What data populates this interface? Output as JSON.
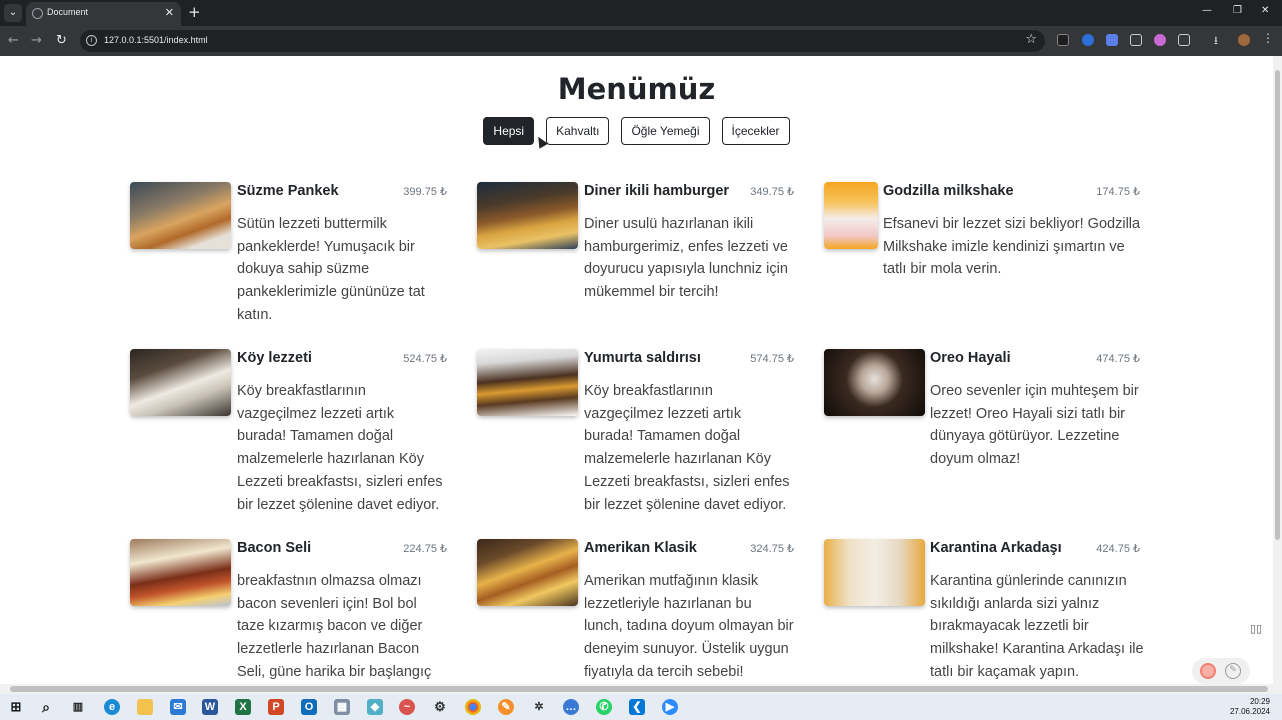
{
  "browser": {
    "tab_title": "Document",
    "url": "127.0.0.1:5501/index.html"
  },
  "page": {
    "heading": "Menümüz",
    "filters": [
      "Hepsi",
      "Kahvaltı",
      "Öğle Yemeği",
      "İçecekler"
    ],
    "active_filter": "Hepsi",
    "items": [
      {
        "title": "Süzme Pankek",
        "price": "399.75 ₺",
        "desc": "Sütün lezzeti buttermilk pankeklerde! Yumuşacık bir dokuya sahip süzme pankeklerimizle gününüze tat katın.",
        "image": "pancake-stack-photo"
      },
      {
        "title": "Diner ikili hamburger",
        "price": "349.75 ₺",
        "desc": "Diner usulü hazırlanan ikili hamburgerimiz, enfes lezzeti ve doyurucu yapısıyla lunchniz için mükemmel bir tercih!",
        "image": "double-burger-photo"
      },
      {
        "title": "Godzilla milkshake",
        "price": "174.75 ₺",
        "desc": "Efsanevi bir lezzet sizi bekliyor! Godzilla Milkshake imizle kendinizi şımartın ve tatlı bir mola verin.",
        "image": "milkshake-photo"
      },
      {
        "title": "Köy lezzeti",
        "price": "524.75 ₺",
        "desc": "Köy breakfastlarının vazgeçilmez lezzeti artık burada! Tamamen doğal malzemelerle hazırlanan Köy Lezzeti breakfastsı, sizleri enfes bir lezzet şölenine davet ediyor.",
        "image": "village-breakfast-photo"
      },
      {
        "title": "Yumurta saldırısı",
        "price": "574.75 ₺",
        "desc": "Köy breakfastlarının vazgeçilmez lezzeti artık burada! Tamamen doğal malzemelerle hazırlanan Köy Lezzeti breakfastsı, sizleri enfes bir lezzet şölenine davet ediyor.",
        "image": "egg-burger-photo"
      },
      {
        "title": "Oreo Hayali",
        "price": "474.75 ₺",
        "desc": "Oreo sevenler için muhteşem bir lezzet! Oreo Hayali sizi tatlı bir dünyaya götürüyor. Lezzetine doyum olmaz!",
        "image": "oreo-shake-photo"
      },
      {
        "title": "Bacon Seli",
        "price": "224.75 ₺",
        "desc": "breakfastnın olmazsa olmazı bacon sevenleri için! Bol bol taze kızarmış bacon ve diğer lezzetlerle hazırlanan Bacon Seli, güne harika bir başlangıç",
        "image": "bacon-sandwich-photo"
      },
      {
        "title": "Amerikan Klasik",
        "price": "324.75 ₺",
        "desc": "Amerikan mutfağının klasik lezzetleriyle hazırlanan bu lunch, tadına doyum olmayan bir deneyim sunuyor. Üstelik uygun fiyatıyla da tercih sebebi!",
        "image": "burger-fries-photo"
      },
      {
        "title": "Karantina Arkadaşı",
        "price": "424.75 ₺",
        "desc": "Karantina günlerinde canınızın sıkıldığı anlarda sizi yalnız bırakmayacak lezzetli bir milkshake! Karantina Arkadaşı ile tatlı bir kaçamak yapın.",
        "image": "couple-milkshake-photo"
      }
    ]
  },
  "taskbar": {
    "time": "20:29",
    "date": "27.06.2024"
  }
}
